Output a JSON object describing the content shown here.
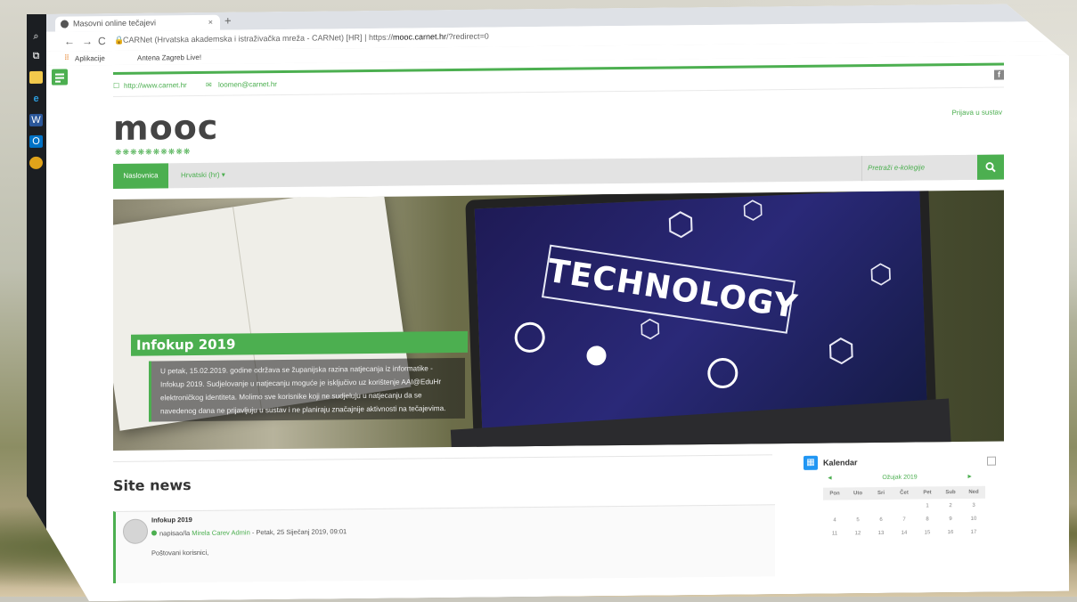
{
  "browser": {
    "tab_title": "Masovni online tečajevi",
    "tab_close": "×",
    "new_tab": "+",
    "url_site": "CARNet (Hrvatska akademska i istraživačka mreža - CARNet) [HR]",
    "url_separator": "|",
    "url_prefix": "https://",
    "url_domain": "mooc.carnet.hr",
    "url_path": "/?redirect=0",
    "bookmark_apps": "Aplikacije",
    "bookmark_1": "Antena Zagreb Live!"
  },
  "header": {
    "website": "http://www.carnet.hr",
    "email": "loomen@carnet.hr",
    "facebook": "f",
    "logo": "mooc",
    "logo_dots": "❋❋❋❋❋❋❋❋❋❋",
    "login": "Prijava u sustav"
  },
  "nav": {
    "home": "Naslovnica",
    "language": "Hrvatski (hr) ▾",
    "search_placeholder": "Pretraži e-kolegije"
  },
  "slide": {
    "screen_word": "TECHNOLOGY",
    "title": "Infokup 2019",
    "text": "U petak, 15.02.2019. godine održava se županijska razina natjecanja iz informatike - Infokup 2019. Sudjelovanje u natjecanju moguće je isključivo uz korištenje AAI@EduHr elektroničkog identiteta. Molimo sve korisnike koji ne sudjeluju u natjecanju da se navedenog dana ne prijavljuju u sustav i ne planiraju značajnije aktivnosti na tečajevima."
  },
  "news": {
    "heading": "Site news",
    "post_title": "Infokup 2019",
    "posted_by": "napisao/la",
    "author": "Mirela Carev Admin",
    "date": "- Petak, 25 Siječanj 2019, 09:01",
    "greeting": "Poštovani korisnici,"
  },
  "calendar": {
    "title": "Kalendar",
    "month": "Ožujak 2019",
    "prev": "◄",
    "next": "►",
    "weekdays": [
      "Pon",
      "Uto",
      "Sri",
      "Čet",
      "Pet",
      "Sub",
      "Ned"
    ],
    "weeks": [
      [
        "",
        "",
        "",
        "",
        "1",
        "2",
        "3"
      ],
      [
        "4",
        "5",
        "6",
        "7",
        "8",
        "9",
        "10"
      ],
      [
        "11",
        "12",
        "13",
        "14",
        "15",
        "16",
        "17"
      ]
    ]
  },
  "colors": {
    "accent": "#4caf50",
    "calendar_icon": "#2196f3"
  }
}
